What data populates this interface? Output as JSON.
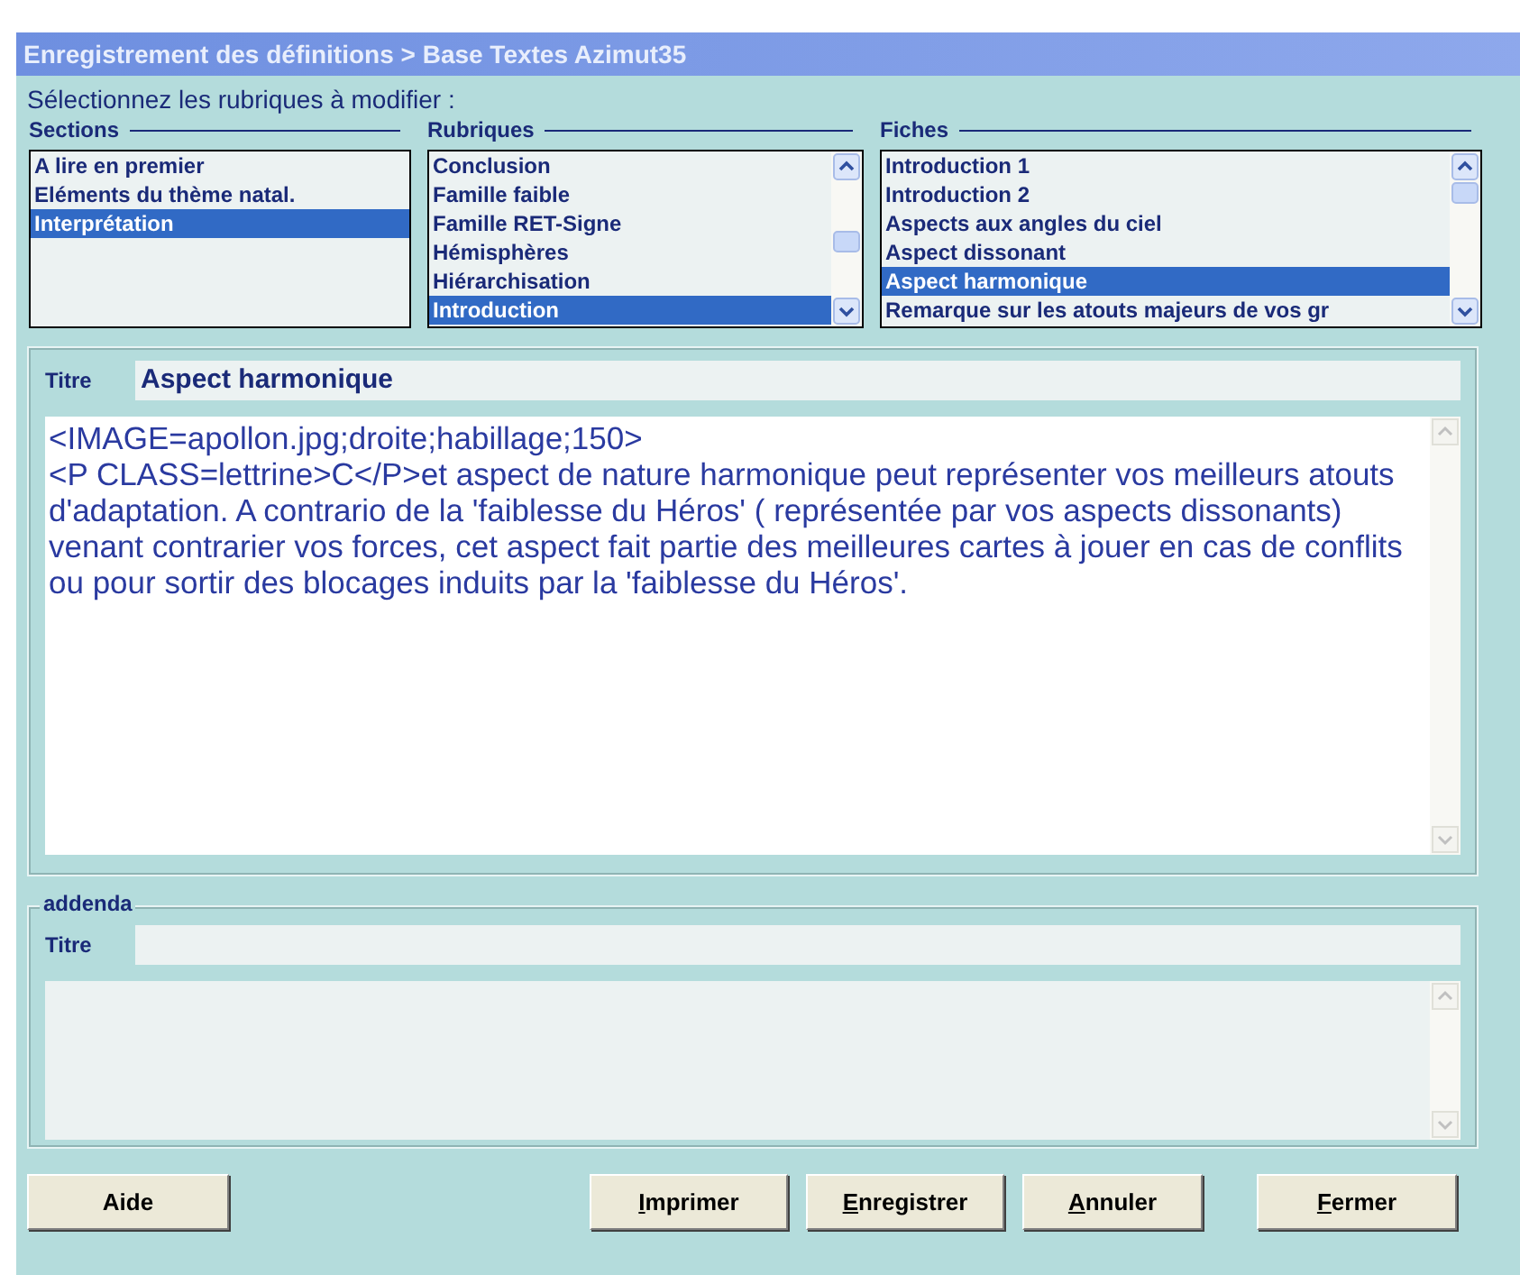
{
  "window": {
    "title": "Enregistrement des définitions > Base Textes Azimut35"
  },
  "prompt": "Sélectionnez les rubriques à modifier :",
  "lists": [
    {
      "label": "Sections",
      "scrollbar": false,
      "items": [
        {
          "text": "A lire en premier",
          "selected": false
        },
        {
          "text": "Eléments du thème natal.",
          "selected": false
        },
        {
          "text": "Interprétation",
          "selected": true
        }
      ]
    },
    {
      "label": "Rubriques",
      "scrollbar": true,
      "items": [
        {
          "text": "Conclusion",
          "selected": false
        },
        {
          "text": "Famille faible",
          "selected": false
        },
        {
          "text": "Famille RET-Signe",
          "selected": false
        },
        {
          "text": "Hémisphères",
          "selected": false
        },
        {
          "text": "Hiérarchisation",
          "selected": false
        },
        {
          "text": "Introduction",
          "selected": true
        }
      ]
    },
    {
      "label": "Fiches",
      "scrollbar": true,
      "items": [
        {
          "text": "Introduction 1",
          "selected": false
        },
        {
          "text": "Introduction 2",
          "selected": false
        },
        {
          "text": "Aspects aux angles du ciel",
          "selected": false
        },
        {
          "text": "Aspect dissonant",
          "selected": false
        },
        {
          "text": "Aspect harmonique",
          "selected": true
        },
        {
          "text": "Remarque sur les atouts majeurs de vos gr",
          "selected": false
        }
      ]
    }
  ],
  "main": {
    "title_label": "Titre",
    "title_value": "Aspect harmonique",
    "body": [
      "<IMAGE=apollon.jpg;droite;habillage;150>",
      "<P CLASS=lettrine>C</P>et aspect de nature harmonique peut représenter vos meilleurs atouts d'adaptation. A contrario de la 'faiblesse du Héros' ( représentée par vos aspects dissonants) venant contrarier vos forces, cet aspect fait partie des meilleures cartes à jouer en cas de conflits ou pour sortir des blocages induits par la 'faiblesse du Héros'."
    ]
  },
  "addenda": {
    "legend": "addenda",
    "title_label": "Titre"
  },
  "buttons": [
    {
      "label": "Aide",
      "mnemonic": false
    },
    {
      "label": "Imprimer",
      "mnemonic": true
    },
    {
      "label": "Enregistrer",
      "mnemonic": true
    },
    {
      "label": "Annuler",
      "mnemonic": true
    },
    {
      "label": "Fermer",
      "mnemonic": true
    }
  ]
}
